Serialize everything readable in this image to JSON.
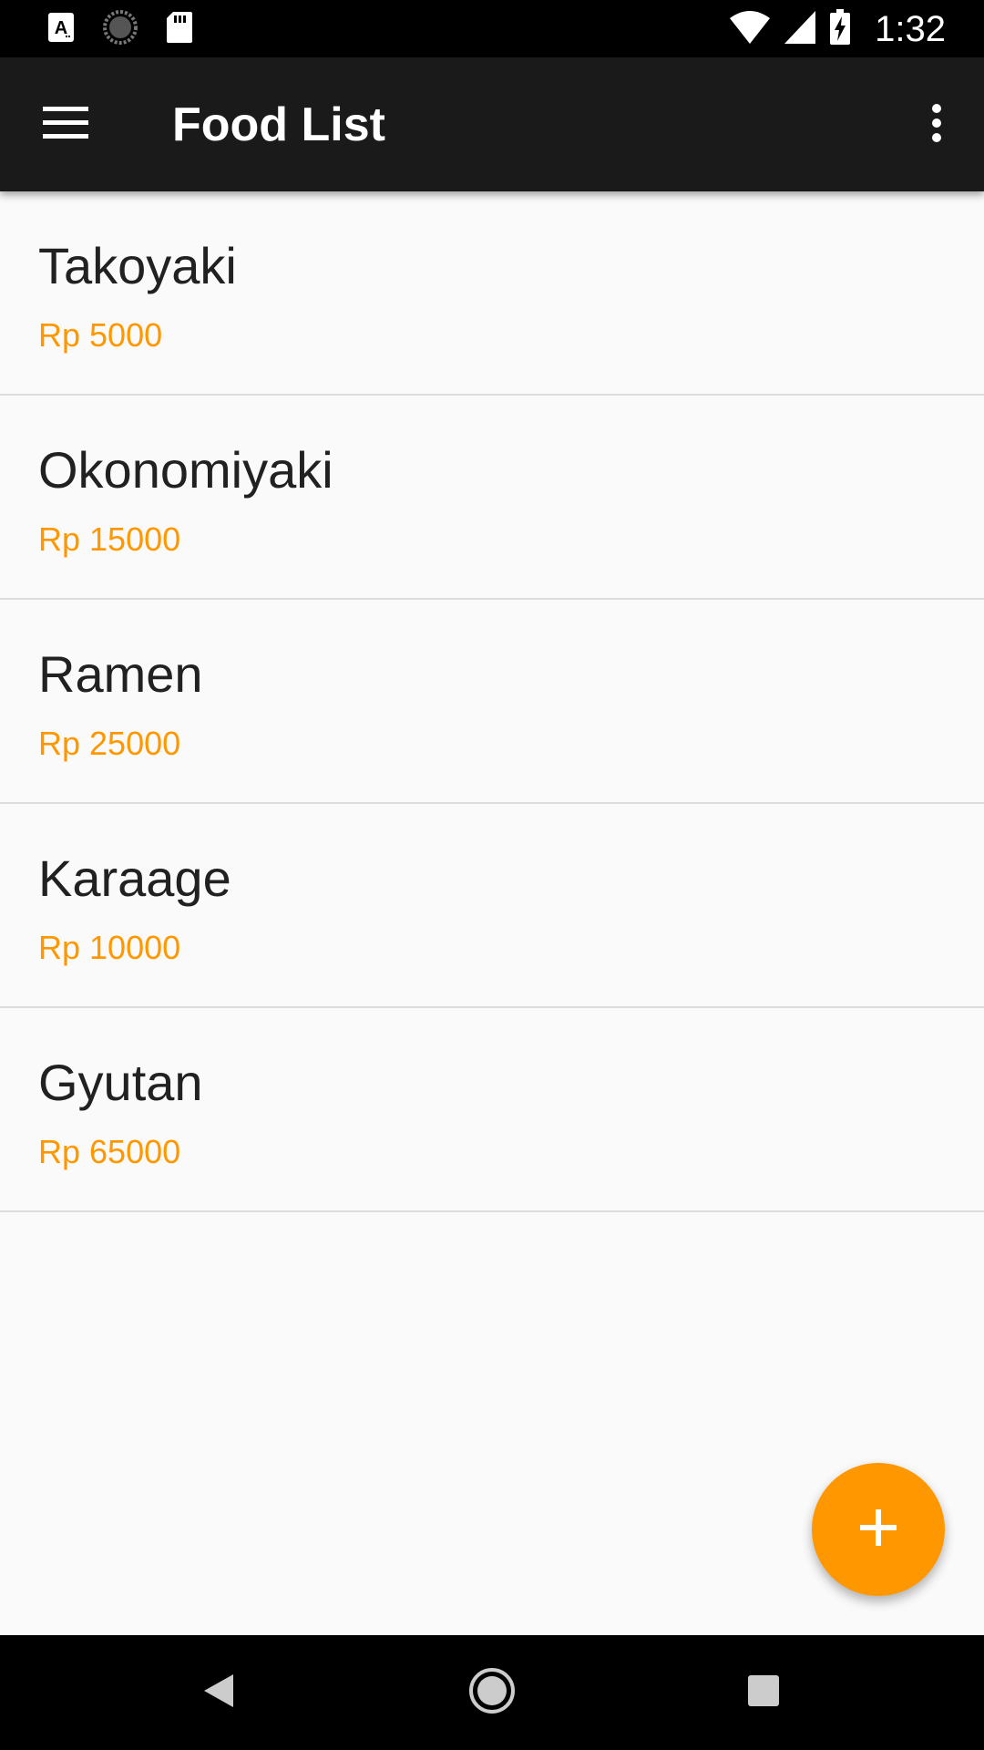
{
  "status_bar": {
    "time": "1:32",
    "left_icons": [
      "a-keyboard-icon",
      "sync-progress-icon",
      "sd-card-icon"
    ],
    "right_icons": [
      "wifi-icon",
      "cell-signal-icon",
      "battery-charging-icon"
    ]
  },
  "app_bar": {
    "title": "Food List",
    "menu_icon": "hamburger-menu-icon",
    "overflow_icon": "more-vert-icon"
  },
  "foods": [
    {
      "name": "Takoyaki",
      "price": "Rp 5000"
    },
    {
      "name": "Okonomiyaki",
      "price": "Rp 15000"
    },
    {
      "name": "Ramen",
      "price": "Rp 25000"
    },
    {
      "name": "Karaage",
      "price": "Rp 10000"
    },
    {
      "name": "Gyutan",
      "price": "Rp 65000"
    }
  ],
  "fab": {
    "icon": "plus-icon"
  },
  "nav_bar": {
    "buttons": [
      "back-icon",
      "home-icon",
      "recents-icon"
    ]
  },
  "colors": {
    "accent": "#ff9800",
    "app_bar": "#1a1a1a",
    "background": "#fafafa",
    "text_primary": "#212121"
  }
}
